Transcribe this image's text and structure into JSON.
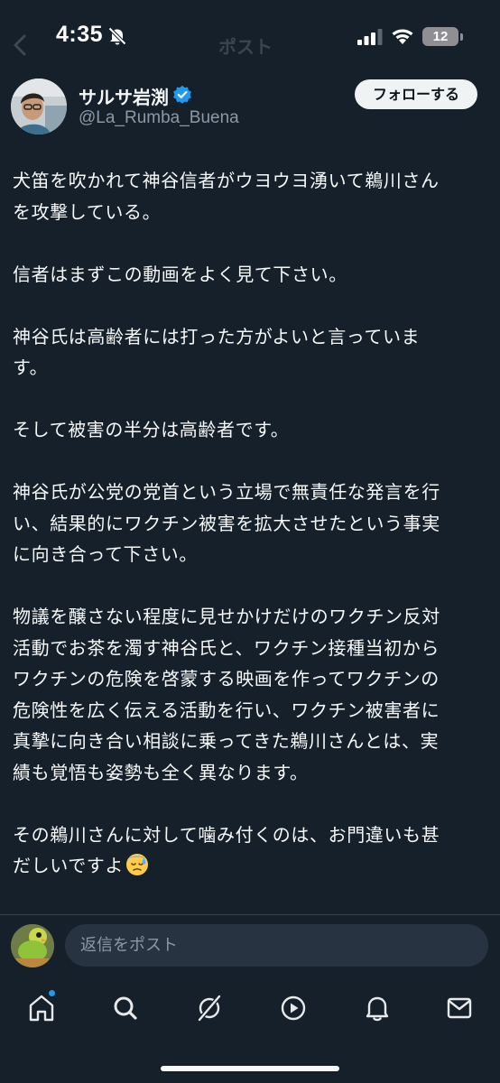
{
  "status_bar": {
    "time": "4:35",
    "battery": "12"
  },
  "header_ghost": {
    "title": "ポスト"
  },
  "author": {
    "name": "サルサ岩渕",
    "handle": "@La_Rumba_Buena",
    "follow_label": "フォローする"
  },
  "tweet": {
    "paragraphs": [
      "犬笛を吹かれて神谷信者がウヨウヨ湧いて鵜川さん\nを攻撃している。",
      "信者はまずこの動画をよく見て下さい。",
      "神谷氏は高齢者には打った方がよいと言っていま\nす。",
      "そして被害の半分は高齢者です。",
      "神谷氏が公党の党首という立場で無責任な発言を行\nい、結果的にワクチン被害を拡大させたという事実\nに向き合って下さい。",
      "物議を醸さない程度に見せかけだけのワクチン反対\n活動でお茶を濁す神谷氏と、ワクチン接種当初から\nワクチンの危険を啓蒙する映画を作ってワクチンの\n危険性を広く伝える活動を行い、ワクチン被害者に\n真摯に向き合い相談に乗ってきた鵜川さんとは、実\n績も覚悟も姿勢も全く異なります。",
      "その鵜川さんに対して噛み付くのは、お門違いも甚\nだしいですよ"
    ],
    "trailing_emoji": "downcast-face-with-sweat-emoji"
  },
  "reply": {
    "placeholder": "返信をポスト"
  },
  "tab_bar": {
    "items": [
      "home-icon",
      "search-icon",
      "grok-icon",
      "video-icon",
      "notifications-icon",
      "messages-icon"
    ],
    "home_has_badge": true
  },
  "colors": {
    "background": "#15202b",
    "text": "#f7f9f9",
    "secondary_text": "#8b98a5",
    "accent": "#1d9bf0",
    "input_bg": "#273340"
  }
}
